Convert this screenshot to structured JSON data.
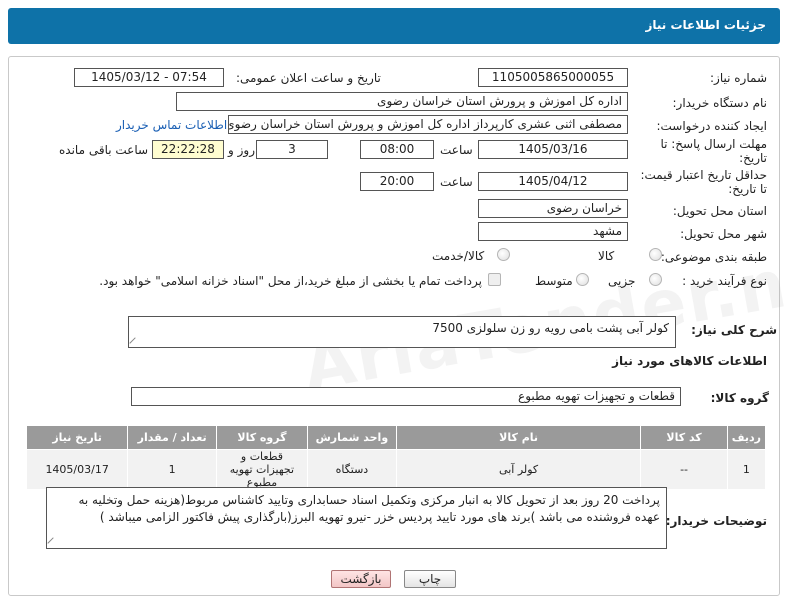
{
  "header": {
    "title": "جزئیات اطلاعات نیاز"
  },
  "watermark": "AriaTender.net",
  "fields": {
    "need_number": {
      "label": "شماره نیاز:",
      "value": "1105005865000055"
    },
    "announce_datetime": {
      "label": "تاریخ و ساعت اعلان عمومی:",
      "value": "1405/03/12 - 07:54"
    },
    "buyer_org": {
      "label": "نام دستگاه خریدار:",
      "value": "اداره کل اموزش و پرورش استان خراسان رضوی"
    },
    "requester": {
      "label": "ایجاد کننده درخواست:",
      "value": "مصطفی اثنی عشری کارپرداز اداره کل اموزش و پرورش استان خراسان رضوی",
      "contact_link": "اطلاعات تماس خریدار"
    },
    "reply_deadline": {
      "label_line1": "مهلت ارسال پاسخ: تا",
      "label_line2": "تاریخ:",
      "date": "1405/03/16",
      "time_label": "ساعت",
      "time": "08:00",
      "days": "3",
      "days_label": "روز و",
      "remaining": "22:22:28",
      "remaining_label": "ساعت باقی مانده"
    },
    "price_validity": {
      "label_line1": "حداقل تاریخ اعتبار قیمت:",
      "label_line2": "تا تاریخ:",
      "date": "1405/04/12",
      "time_label": "ساعت",
      "time": "20:00"
    },
    "delivery_province": {
      "label": "استان محل تحویل:",
      "value": "خراسان رضوی"
    },
    "delivery_city": {
      "label": "شهر محل تحویل:",
      "value": "مشهد"
    },
    "category": {
      "label": "طبقه بندی موضوعی:",
      "options": [
        "کالا",
        "کالا/خدمت"
      ]
    },
    "purchase_type": {
      "label": "نوع فرآیند خرید :",
      "options": [
        "جزیی",
        "متوسط"
      ],
      "checkbox_text": "پرداخت تمام یا بخشی از مبلغ خرید،از محل \"اسناد خزانه اسلامی\" خواهد بود."
    }
  },
  "general_description": {
    "label": "شرح کلی نیاز:",
    "value": "کولر آبی پشت بامی رویه رو زن سلولزی 7500"
  },
  "goods_section": {
    "title": "اطلاعات کالاهای مورد نیاز",
    "group_label": "گروه کالا:",
    "group_value": "قطعات و تجهیزات تهویه مطبوع"
  },
  "items_table": {
    "headers": [
      "ردیف",
      "کد کالا",
      "نام کالا",
      "واحد شمارش",
      "گروه کالا",
      "تعداد / مقدار",
      "تاریخ نیاز"
    ],
    "rows": [
      [
        "1",
        "--",
        "کولر آبی",
        "دستگاه",
        "قطعات و تجهیزات تهویه مطبوع",
        "1",
        "1405/03/17"
      ]
    ]
  },
  "buyer_notes": {
    "label": "توضیحات خریدار:",
    "value": "پرداخت 20 روز بعد از تحویل کالا به انبار مرکزی وتکمیل اسناد حسابداری  وتایید کاشناس مربوط(هزینه حمل وتخلیه به عهده فروشنده می باشد )برند های مورد تایید پردیس خزر -نیرو تهویه البرز(بارگذاری پیش فاکتور الزامی میباشد )"
  },
  "buttons": {
    "print": "چاپ",
    "back": "بازگشت"
  }
}
